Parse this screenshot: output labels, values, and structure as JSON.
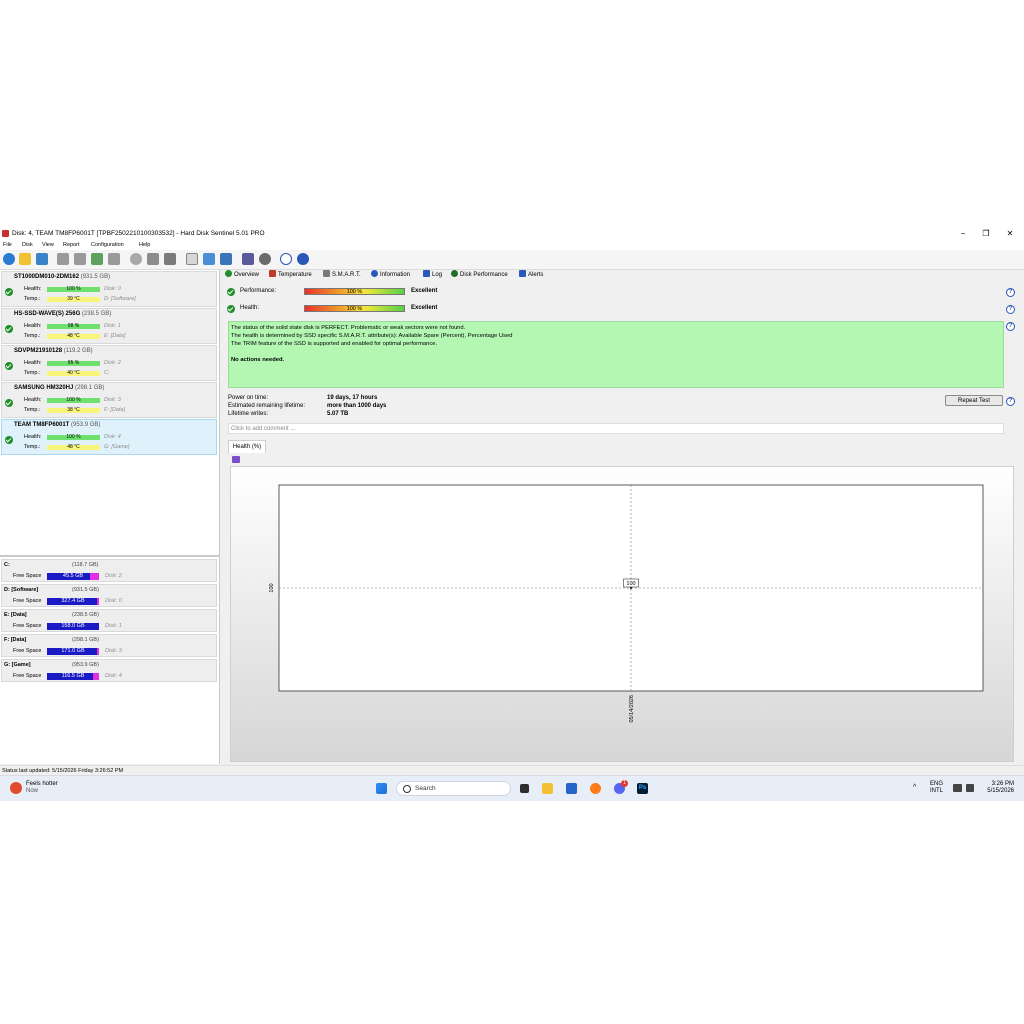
{
  "window": {
    "title": "Disk: 4, TEAM TM8FP6001T [TPBF2502210100303532]  -  Hard Disk Sentinel 5.01 PRO",
    "minimize_glyph": "−",
    "restore_glyph": "❐",
    "close_glyph": "✕"
  },
  "menu": [
    "File",
    "Disk",
    "View",
    "Report",
    "Configuration",
    "Help"
  ],
  "toolbar_icons": [
    "refresh-icon",
    "alert-icon",
    "disk-info-icon",
    "wrench-icon",
    "wrench-icon",
    "wrench-check-icon",
    "wrench-icon",
    "gray-disk-icon",
    "gray-disk-icon",
    "gray-disk-icon",
    "document-icon",
    "backup-icon",
    "network-icon",
    "report-icon",
    "gear-icon",
    "help-icon",
    "info-icon"
  ],
  "disks": [
    {
      "name": "ST1000DM010-2DM162",
      "size": "(931.5 GB)",
      "health_label": "Health:",
      "health": "100 %",
      "health_fraction": 1.0,
      "disk_ref": "Disk: 0",
      "temp_label": "Temp.:",
      "temp": "39 °C",
      "temp_fraction": 0.55,
      "volume_ref": "D: [Software]"
    },
    {
      "name": "HS-SSD-WAVE(S) 256G",
      "size": "(238.5 GB)",
      "health_label": "Health:",
      "health": "98 %",
      "health_fraction": 0.98,
      "disk_ref": "Disk: 1",
      "temp_label": "Temp.:",
      "temp": "48 °C",
      "temp_fraction": 0.55,
      "volume_ref": "E: [Data]"
    },
    {
      "name": "SDVPM21910128",
      "size": "(119.2 GB)",
      "health_label": "Health:",
      "health": "95 %",
      "health_fraction": 0.95,
      "disk_ref": "Disk: 2",
      "temp_label": "Temp.:",
      "temp": "40 °C",
      "temp_fraction": 0.55,
      "volume_ref": "C:"
    },
    {
      "name": "SAMSUNG HM320HJ",
      "size": "(298.1 GB)",
      "health_label": "Health:",
      "health": "100 %",
      "health_fraction": 1.0,
      "disk_ref": "Disk: 3",
      "temp_label": "Temp.:",
      "temp": "38 °C",
      "temp_fraction": 0.55,
      "volume_ref": "F: [Data]"
    },
    {
      "name": "TEAM TM8FP6001T",
      "size": "(953.9 GB)",
      "health_label": "Health:",
      "health": "100 %",
      "health_fraction": 1.0,
      "disk_ref": "Disk: 4",
      "temp_label": "Temp.:",
      "temp": "48 °C",
      "temp_fraction": 0.55,
      "volume_ref": "G: [Game]",
      "selected": true
    }
  ],
  "volumes": [
    {
      "name": "C:",
      "size": "(118.7 GB)",
      "free_label": "Free Space",
      "free": "45.5 GB",
      "free_fraction": 0.38,
      "disk_ref": "Disk: 2"
    },
    {
      "name": "D: [Software]",
      "size": "(931.5 GB)",
      "free_label": "Free Space",
      "free": "327.4 GB",
      "free_fraction": 0.35,
      "disk_ref": "Disk: 0"
    },
    {
      "name": "E: [Data]",
      "size": "(238.5 GB)",
      "free_label": "Free Space",
      "free": "158.0 GB",
      "free_fraction": 0.66,
      "disk_ref": "Disk: 1"
    },
    {
      "name": "F: [Data]",
      "size": "(298.1 GB)",
      "free_label": "Free Space",
      "free": "171.0 GB",
      "free_fraction": 0.57,
      "disk_ref": "Disk: 3"
    },
    {
      "name": "G: [Game]",
      "size": "(953.9 GB)",
      "free_label": "Free Space",
      "free": "116.5 GB",
      "free_fraction": 0.88,
      "disk_ref": "Disk: 4"
    }
  ],
  "tabs": [
    {
      "label": "Overview",
      "icon": "check-icon",
      "color": "#1f8f2a"
    },
    {
      "label": "Temperature",
      "icon": "thermometer-icon",
      "color": "#c0392b"
    },
    {
      "label": "S.M.A.R.T.",
      "icon": "smart-icon",
      "color": "#7a7a7a"
    },
    {
      "label": "Information",
      "icon": "info-icon",
      "color": "#2a58b8"
    },
    {
      "label": "Log",
      "icon": "log-icon",
      "color": "#2a58b8"
    },
    {
      "label": "Disk Performance",
      "icon": "performance-icon",
      "color": "#1f6f2a"
    },
    {
      "label": "Alerts",
      "icon": "alerts-icon",
      "color": "#2a58b8"
    }
  ],
  "overview": {
    "performance": {
      "label": "Performance:",
      "value": "100 %",
      "result": "Excellent"
    },
    "health": {
      "label": "Health:",
      "value": "100 %",
      "result": "Excellent"
    },
    "status_lines": [
      "The status of the solid state disk is PERFECT. Problematic or weak sectors were not found.",
      "The health is determined by SSD specific S.M.A.R.T. attribute(s):  Available Spare (Percent),  Percentage Used",
      "The TRIM feature of the SSD is supported and enabled for optimal performance.",
      "",
      "No actions needed."
    ],
    "power_on_label": "Power on time:",
    "power_on_value": "19 days, 17 hours",
    "remaining_label": "Estimated remaining lifetime:",
    "remaining_value": "more than 1000 days",
    "writes_label": "Lifetime writes:",
    "writes_value": "5.07 TB",
    "repeat_button": "Repeat Test",
    "comment_placeholder": "Click to add comment ...",
    "help_glyph": "?"
  },
  "chart_tab": "Health (%)",
  "chart_data": {
    "type": "line",
    "title": "",
    "xlabel": "",
    "ylabel": "",
    "x": [
      "05/14/2026"
    ],
    "series": [
      {
        "values": [
          100
        ]
      }
    ],
    "point_label": "100",
    "y_tick": "100",
    "x_tick": "05/14/2026",
    "grid": true
  },
  "statusbar": "Status last updated: 5/15/2026 Friday 3:26:52 PM",
  "taskbar": {
    "weather_title": "Feels hotter",
    "weather_sub": "Now",
    "search_placeholder": "Search",
    "lang_top": "ENG",
    "lang_bottom": "INTL",
    "time": "3:26 PM",
    "date": "5/15/2026",
    "chevron_glyph": "^",
    "photoshop_label": "Ps",
    "discord_badge": "1"
  }
}
